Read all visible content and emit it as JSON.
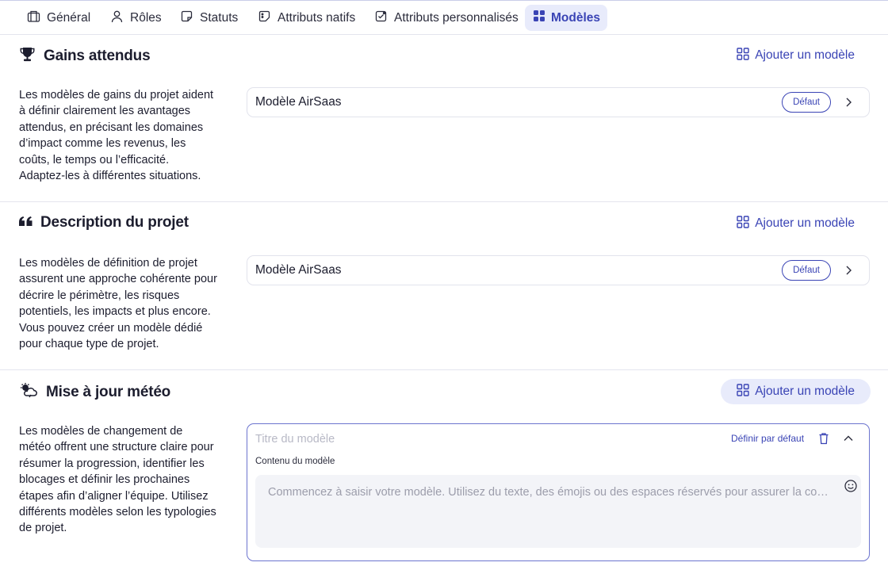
{
  "tabs": [
    {
      "label": "Général",
      "icon": "building-icon"
    },
    {
      "label": "Rôles",
      "icon": "user-icon"
    },
    {
      "label": "Statuts",
      "icon": "status-icon"
    },
    {
      "label": "Attributs natifs",
      "icon": "native-attributes-icon"
    },
    {
      "label": "Attributs personnalisés",
      "icon": "custom-attributes-icon"
    },
    {
      "label": "Modèles",
      "icon": "grid-icon",
      "active": true
    }
  ],
  "sections": [
    {
      "icon": "trophy-icon",
      "title": "Gains attendus",
      "add_label": "Ajouter un modèle",
      "description": "Les modèles de gains du projet aident à définir clairement les avantages attendus, en précisant les domaines d’impact comme les revenus, les coûts, le temps ou l’efficacité. Adaptez-les à différentes situations.",
      "model": {
        "name": "Modèle AirSaas",
        "badge": "Défaut"
      }
    },
    {
      "icon": "quote-icon",
      "title": "Description du projet",
      "add_label": "Ajouter un modèle",
      "description": "Les modèles de définition de projet assurent une approche cohérente pour décrire le périmètre, les risques potentiels, les impacts et plus encore. Vous pouvez créer un modèle dédié pour chaque type de projet.",
      "model": {
        "name": "Modèle AirSaas",
        "badge": "Défaut"
      }
    },
    {
      "icon": "weather-icon",
      "title": "Mise à jour météo",
      "add_label": "Ajouter un modèle",
      "description": "Les modèles de changement de météo offrent une structure claire pour résumer la progression, identifier les blocages et définir les prochaines étapes afin d’aligner l’équipe. Utilisez différents modèles selon les typologies de projet.",
      "editor": {
        "title_placeholder": "Titre du modèle",
        "set_default_label": "Définir par défaut",
        "content_label": "Contenu du modèle",
        "content_placeholder": "Commencez à saisir votre modèle. Utilisez du texte, des émojis ou des espaces réservés pour assurer la cohé…"
      }
    }
  ],
  "colors": {
    "accent": "#3a44b5",
    "active_tab_bg": "#e8ebfb",
    "border": "#e4e5ee",
    "text": "#1c1d2e"
  }
}
